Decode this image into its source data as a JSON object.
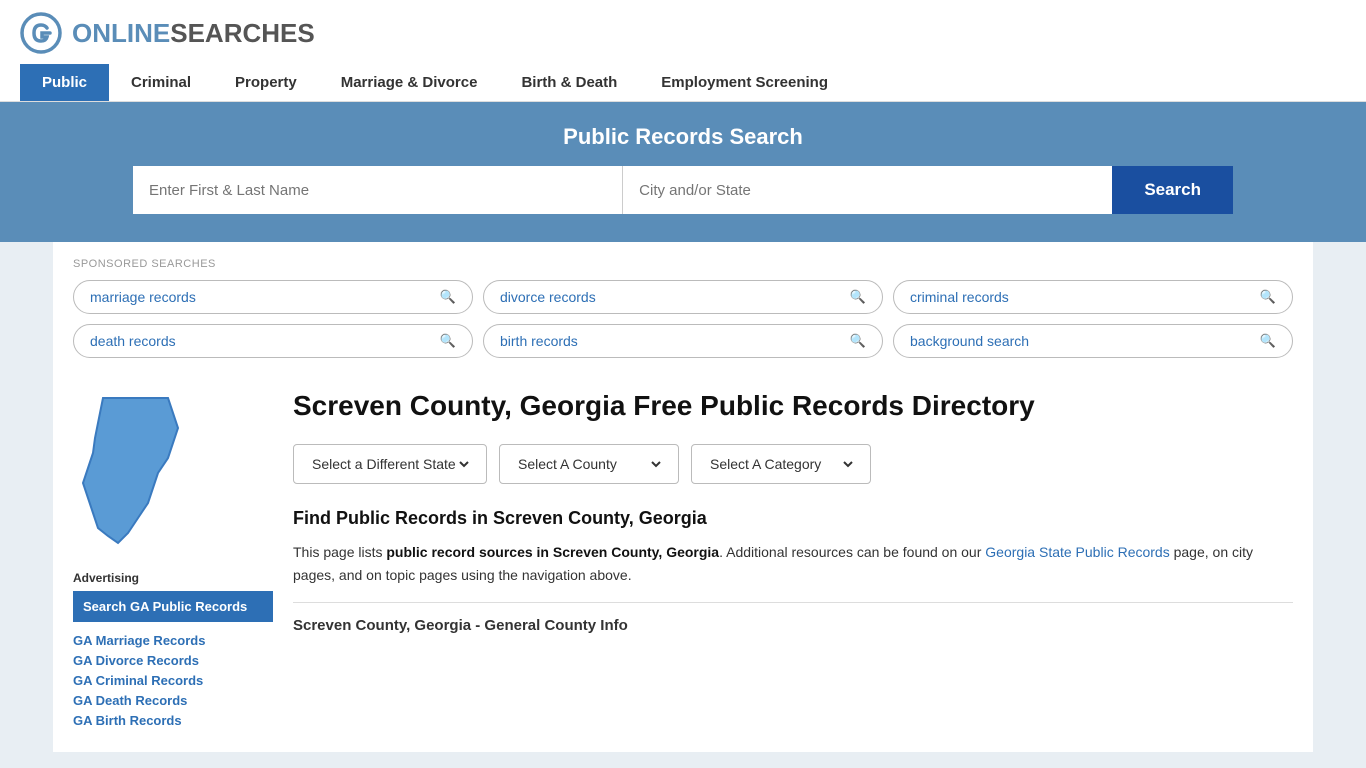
{
  "logo": {
    "text_online": "ONLINE",
    "text_searches": "SEARCHES",
    "icon_label": "OnlineSearches logo"
  },
  "nav": {
    "items": [
      {
        "label": "Public",
        "active": true
      },
      {
        "label": "Criminal",
        "active": false
      },
      {
        "label": "Property",
        "active": false
      },
      {
        "label": "Marriage & Divorce",
        "active": false
      },
      {
        "label": "Birth & Death",
        "active": false
      },
      {
        "label": "Employment Screening",
        "active": false
      }
    ]
  },
  "search_banner": {
    "title": "Public Records Search",
    "name_placeholder": "Enter First & Last Name",
    "location_placeholder": "City and/or State",
    "button_label": "Search"
  },
  "sponsored": {
    "label": "SPONSORED SEARCHES",
    "items": [
      {
        "label": "marriage records"
      },
      {
        "label": "divorce records"
      },
      {
        "label": "criminal records"
      },
      {
        "label": "death records"
      },
      {
        "label": "birth records"
      },
      {
        "label": "background search"
      }
    ]
  },
  "page": {
    "title": "Screven County, Georgia Free Public Records Directory",
    "state_dropdown": "Select a Different State",
    "county_dropdown": "Select A County",
    "category_dropdown": "Select A Category",
    "find_title": "Find Public Records in Screven County, Georgia",
    "find_description_1": "This page lists ",
    "find_description_bold": "public record sources in Screven County, Georgia",
    "find_description_2": ". Additional resources can be found on our ",
    "find_link_text": "Georgia State Public Records",
    "find_description_3": " page, on city pages, and on topic pages using the navigation above.",
    "county_info_title": "Screven County, Georgia - General County Info"
  },
  "sidebar": {
    "ad_label": "Advertising",
    "ad_box_text": "Search GA Public Records",
    "links": [
      {
        "label": "GA Marriage Records"
      },
      {
        "label": "GA Divorce Records"
      },
      {
        "label": "GA Criminal Records"
      },
      {
        "label": "GA Death Records"
      },
      {
        "label": "GA Birth Records"
      }
    ]
  }
}
